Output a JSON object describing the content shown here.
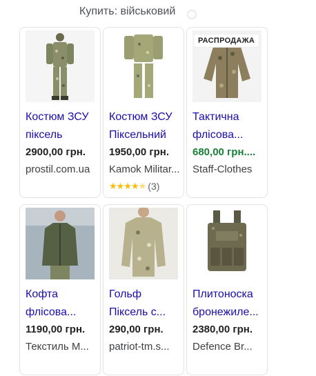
{
  "header": {
    "text": "Купить: військовий"
  },
  "products": [
    {
      "title_line1": "Костюм ЗСУ",
      "title_line2": "піксель",
      "price": "2900,00 грн.",
      "store": "prostil.com.ua",
      "thumb_icon": "camo-suit-person"
    },
    {
      "title_line1": "Костюм ЗСУ",
      "title_line2": "Піксельний",
      "price": "1950,00 грн.",
      "store": "Kamok Militar...",
      "rating_value": 4.5,
      "rating_count": "(3)",
      "thumb_icon": "camo-suit-hanger"
    },
    {
      "badge": "РАСПРОДАЖА",
      "title_line1": "Тактична",
      "title_line2": "флісова...",
      "price": "680,00 грн....",
      "price_sale": true,
      "store": "Staff-Clothes",
      "thumb_icon": "fleece-jacket-camo"
    },
    {
      "title_line1": "Кофта",
      "title_line2": "флісова...",
      "price": "1190,00 грн.",
      "store": "Текстиль М...",
      "thumb_icon": "olive-fleece-person"
    },
    {
      "title_line1": "Гольф",
      "title_line2": "Піксель с...",
      "price": "290,00 грн.",
      "store": "patriot-tm.s...",
      "thumb_icon": "camo-shirt-person"
    },
    {
      "title_line1": "Плитоноска",
      "title_line2": "бронежиле...",
      "price": "2380,00 грн.",
      "store": "Defence Br...",
      "thumb_icon": "plate-carrier"
    }
  ]
}
